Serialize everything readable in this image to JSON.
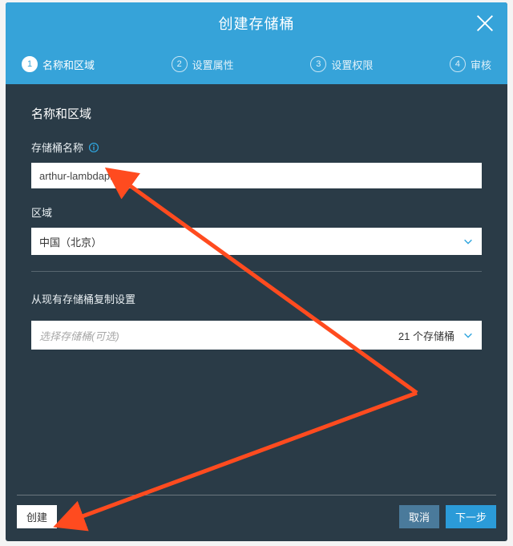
{
  "header": {
    "title": "创建存储桶"
  },
  "steps": [
    {
      "num": "1",
      "label": "名称和区域",
      "active": true
    },
    {
      "num": "2",
      "label": "设置属性",
      "active": false
    },
    {
      "num": "3",
      "label": "设置权限",
      "active": false
    },
    {
      "num": "4",
      "label": "审核",
      "active": false
    }
  ],
  "form": {
    "section_title": "名称和区域",
    "bucket_name_label": "存储桶名称",
    "bucket_name_value": "arthur-lambdapics",
    "region_label": "区域",
    "region_value": "中国（北京）",
    "copy_from_label": "从现有存储桶复制设置",
    "copy_from_placeholder": "选择存储桶(可选)",
    "copy_from_count": "21 个存储桶"
  },
  "footer": {
    "create_label": "创建",
    "cancel_label": "取消",
    "next_label": "下一步"
  },
  "colors": {
    "header": "#36a3d9",
    "panel": "#2a3b47",
    "arrow": "#ff4b1f"
  }
}
